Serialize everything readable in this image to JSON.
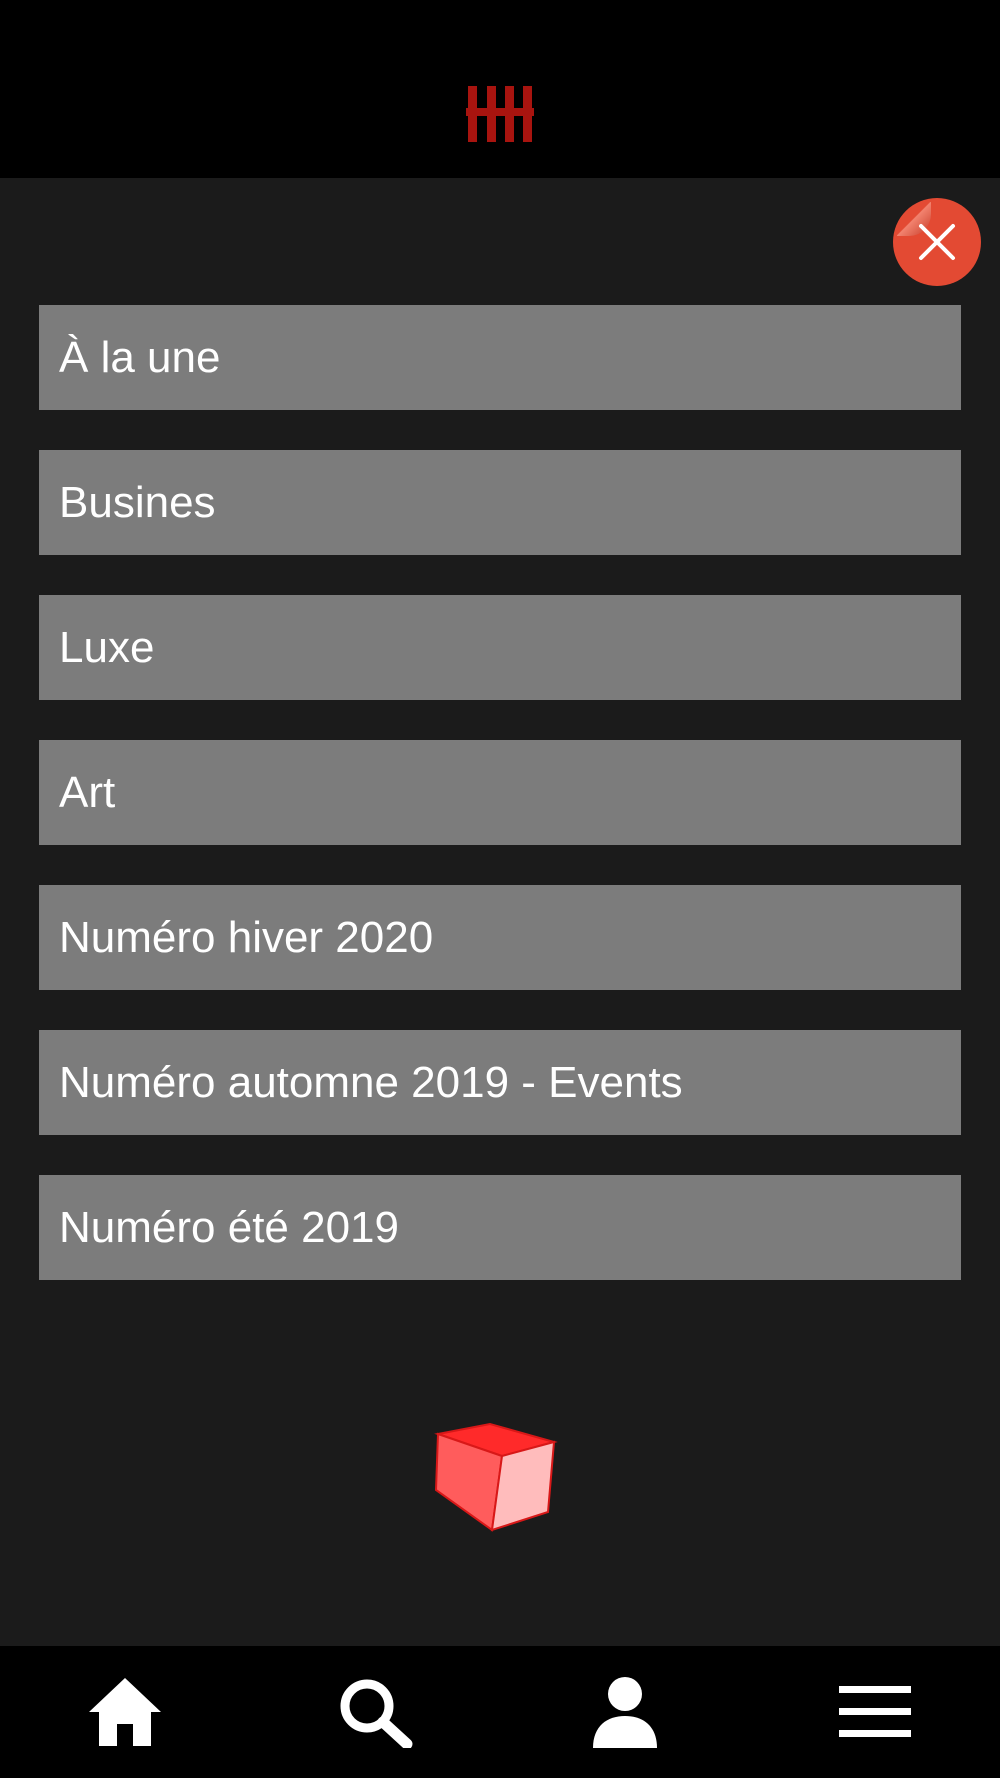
{
  "header": {
    "logo_icon": "bars-logo-icon",
    "logo_color": "#a8140f"
  },
  "overlay": {
    "close_icon": "close-icon",
    "close_color": "#e34a33"
  },
  "menu": {
    "items": [
      {
        "label": "À la une"
      },
      {
        "label": "Busines"
      },
      {
        "label": "Luxe"
      },
      {
        "label": "Art"
      },
      {
        "label": "Numéro hiver 2020"
      },
      {
        "label": "Numéro automne 2019 - Events"
      },
      {
        "label": "Numéro été 2019"
      }
    ]
  },
  "decoration": {
    "cube_icon": "red-cube-icon"
  },
  "tabbar": {
    "tabs": [
      {
        "icon": "home-icon"
      },
      {
        "icon": "search-icon"
      },
      {
        "icon": "user-icon"
      },
      {
        "icon": "hamburger-menu-icon"
      }
    ]
  }
}
